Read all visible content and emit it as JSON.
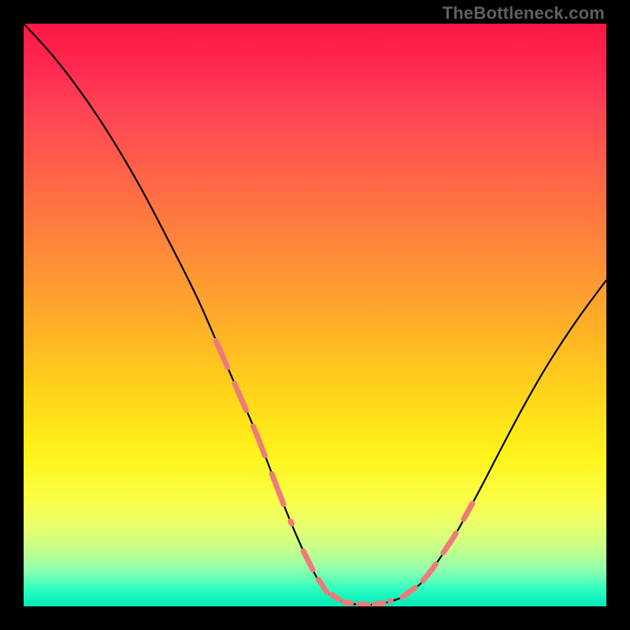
{
  "watermark": "TheBottleneck.com",
  "chart_data": {
    "type": "line",
    "title": "",
    "xlabel": "",
    "ylabel": "",
    "xlim": [
      0,
      100
    ],
    "ylim": [
      0,
      100
    ],
    "grid": false,
    "legend": false,
    "series": [
      {
        "name": "bottleneck-curve",
        "color": "#000000",
        "x": [
          0,
          5,
          10,
          15,
          20,
          25,
          30,
          35,
          40,
          45,
          48,
          50,
          52,
          55,
          58,
          60,
          62,
          65,
          68,
          70,
          74,
          78,
          82,
          86,
          90,
          95,
          100
        ],
        "values": [
          100,
          94.5,
          88.0,
          80.5,
          72.0,
          62.5,
          52.5,
          41.0,
          29.5,
          16.5,
          9.5,
          5.5,
          2.5,
          0.7,
          0.3,
          0.3,
          0.6,
          1.6,
          3.8,
          6.2,
          12.2,
          19.5,
          27.2,
          34.7,
          41.6,
          49.2,
          56.0
        ]
      }
    ],
    "annotations": [
      {
        "name": "pink-dash-segment-left",
        "type": "dashed-overlay",
        "color": "#f28b82",
        "approx_x_range": [
          33,
          46
        ],
        "approx_y_range": [
          45,
          13
        ]
      },
      {
        "name": "pink-dash-segment-bottom",
        "type": "dashed-overlay",
        "color": "#f28b82",
        "approx_x_range": [
          48,
          63
        ],
        "approx_y_range": [
          8,
          2
        ]
      },
      {
        "name": "pink-dash-segment-right",
        "type": "dashed-overlay",
        "color": "#f28b82",
        "approx_x_range": [
          65,
          77
        ],
        "approx_y_range": [
          2,
          18
        ]
      }
    ]
  }
}
